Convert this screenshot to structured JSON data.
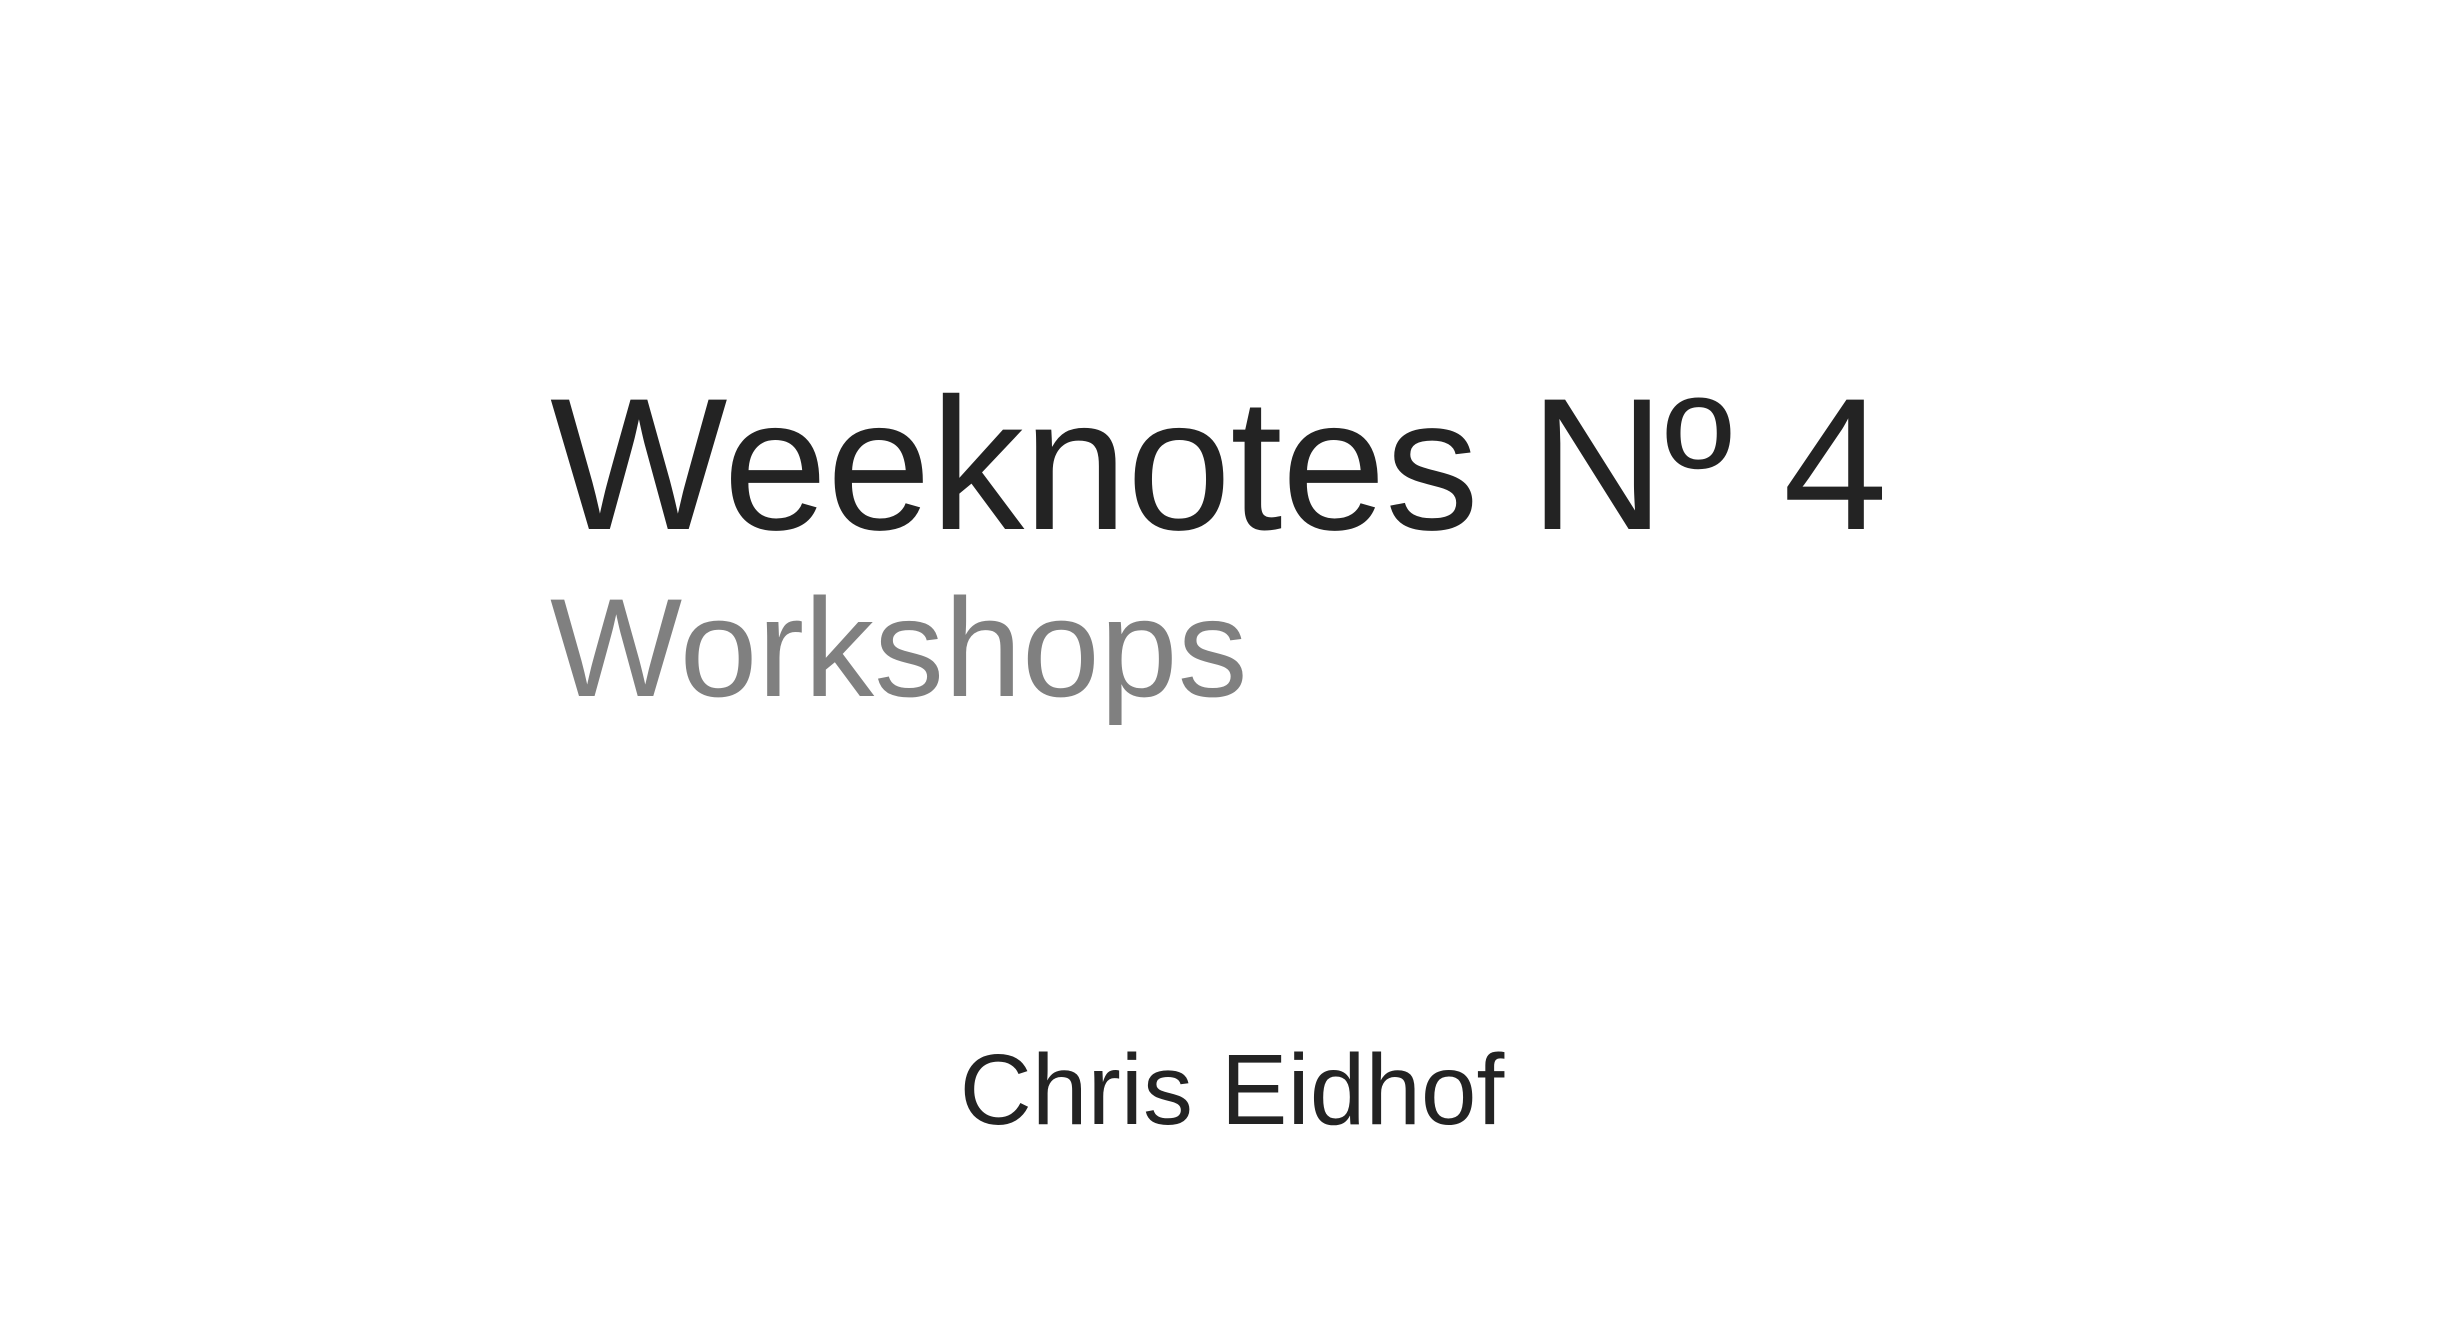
{
  "slide": {
    "title": "Weeknotes Nº 4",
    "subtitle": "Workshops",
    "author": "Chris Eidhof"
  },
  "colors": {
    "background": "#ffffff",
    "title": "#232323",
    "subtitle": "#808080",
    "author": "#232323"
  }
}
